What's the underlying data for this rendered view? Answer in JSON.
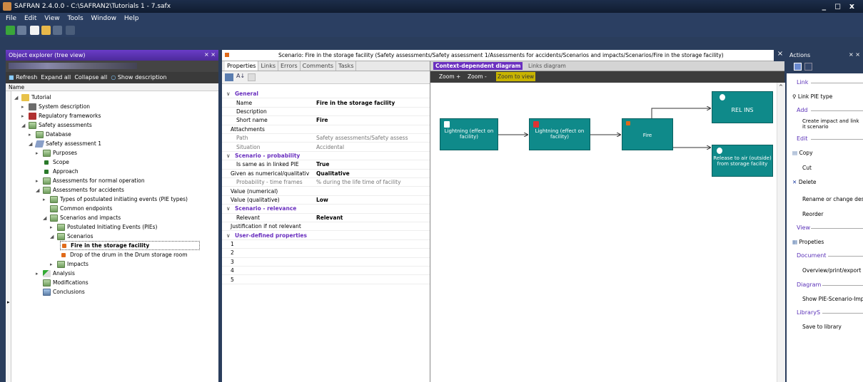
{
  "window": {
    "title": "SAFRAN 2.4.0.0 - C:\\SAFRAN2\\Tutorials 1 - 7.safx"
  },
  "menu": [
    "File",
    "Edit",
    "View",
    "Tools",
    "Window",
    "Help"
  ],
  "left": {
    "header": "Object explorer (tree view)",
    "pin": "⨯ ×",
    "toolbar2": {
      "refresh": "Refresh",
      "expand": "Expand all",
      "collapse": "Collapse all",
      "showdesc": "Show description"
    },
    "col": "Name"
  },
  "tree": [
    {
      "label": "Tutorial"
    },
    {
      "label": "System description"
    },
    {
      "label": "Regulatory frameworks"
    },
    {
      "label": "Safety assessments"
    },
    {
      "label": "Database"
    },
    {
      "label": "Safety assessment 1"
    },
    {
      "label": "Purposes"
    },
    {
      "label": "Scope"
    },
    {
      "label": "Approach"
    },
    {
      "label": "Assessments for normal operation"
    },
    {
      "label": "Assessments for accidents"
    },
    {
      "label": "Types of postulated initiating events (PIE types)"
    },
    {
      "label": "Common endpoints"
    },
    {
      "label": "Scenarios and impacts"
    },
    {
      "label": "Postulated Initiating Events (PIEs)"
    },
    {
      "label": "Scenarios"
    },
    {
      "label": "Fire in the storage facility"
    },
    {
      "label": "Drop of the drum in the Drum storage room"
    },
    {
      "label": "Impacts"
    },
    {
      "label": "Analysis"
    },
    {
      "label": "Modifications"
    },
    {
      "label": "Conclusions"
    }
  ],
  "doc": {
    "title": "Scenario: Fire in the storage facility  (Safety assessments/Safety assessment 1/Assessments for accidents/Scenarios and impacts/Scenarios/Fire in the storage facility)",
    "close": "×"
  },
  "mid": {
    "tabs": [
      "Properties",
      "Links",
      "Errors",
      "Comments",
      "Tasks"
    ]
  },
  "props": [
    {
      "n": "General",
      "v": "",
      "t": "cat"
    },
    {
      "n": "Name",
      "v": "Fire in the storage facility",
      "t": ""
    },
    {
      "n": "Description",
      "v": "",
      "t": ""
    },
    {
      "n": "Short name",
      "v": "Fire",
      "t": ""
    },
    {
      "n": "Attachments",
      "v": "",
      "t": "flat"
    },
    {
      "n": "Path",
      "v": "Safety assessments/Safety assess",
      "t": "gray"
    },
    {
      "n": "Situation",
      "v": "Accidental",
      "t": "gray"
    },
    {
      "n": "Scenario - probability",
      "v": "",
      "t": "cat"
    },
    {
      "n": "Is same as in linked PIE",
      "v": "True",
      "t": ""
    },
    {
      "n": "Given as numerical/qualitativ",
      "v": "Qualitative",
      "t": "flat"
    },
    {
      "n": "Probability - time frames",
      "v": "% during the life time of facility",
      "t": "gray"
    },
    {
      "n": "Value (numerical)",
      "v": "",
      "t": "flat"
    },
    {
      "n": "Value (qualitative)",
      "v": "Low",
      "t": "flat"
    },
    {
      "n": "Scenario - relevance",
      "v": "",
      "t": "cat"
    },
    {
      "n": "Relevant",
      "v": "Relevant",
      "t": ""
    },
    {
      "n": "Justification if not relevant",
      "v": "",
      "t": "flat"
    },
    {
      "n": "User-defined properties",
      "v": "",
      "t": "cat"
    },
    {
      "n": "1",
      "v": "",
      "t": "flat"
    },
    {
      "n": "2",
      "v": "",
      "t": "flat"
    },
    {
      "n": "3",
      "v": "",
      "t": "flat"
    },
    {
      "n": "4",
      "v": "",
      "t": "flat"
    },
    {
      "n": "5",
      "v": "",
      "t": "flat"
    }
  ],
  "diagram": {
    "tabs": [
      "Context-dependent diagram",
      "Links diagram"
    ],
    "zoomin": "Zoom +",
    "zoomout": "Zoom -",
    "zoomfit": "Zoom to view",
    "nodes": [
      "Lightning (effect on facility)",
      "Lightning (effect on facility)",
      "Fire",
      "REL INS",
      "Release to air (outside) from storage facility"
    ]
  },
  "actions": {
    "header": "Actions",
    "pin": "⨯ ×",
    "sections": {
      "link": "Link",
      "add": "Add",
      "edit": "Edit",
      "view": "View",
      "document": "Document",
      "diagram": "Diagram",
      "library": "LibraryS"
    },
    "items": {
      "linkpie": "Link PIE type",
      "create": "Create impact and link it scenario",
      "copy": "Copy",
      "cut": "Cut",
      "delete": "Delete",
      "rename": "Rename or change desc",
      "reorder": "Reorder",
      "props": "Propeties",
      "overview": "Overview/print/export a",
      "show": "Show PIE-Scenario-Impa",
      "save": "Save to library"
    }
  },
  "colors": {
    "teal": "#0f8a8a",
    "purple": "#6a3cc7"
  }
}
